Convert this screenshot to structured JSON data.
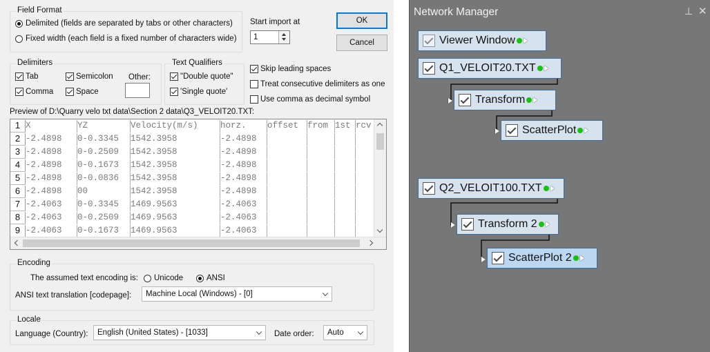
{
  "dialog": {
    "field_format": {
      "legend": "Field Format",
      "delimited_label": "Delimited (fields are separated by tabs or other characters)",
      "fixed_label": "Fixed width (each field is a fixed number of characters wide)"
    },
    "start_import": {
      "label": "Start import at",
      "value": "1"
    },
    "ok_label": "OK",
    "cancel_label": "Cancel",
    "delimiters": {
      "legend": "Delimiters",
      "tab": "Tab",
      "semicolon": "Semicolon",
      "comma": "Comma",
      "space": "Space",
      "other": "Other:",
      "other_value": ""
    },
    "qualifiers": {
      "legend": "Text Qualifiers",
      "double": "\"Double quote\"",
      "single": "'Single quote'"
    },
    "options": {
      "skip_leading": "Skip leading spaces",
      "treat_consecutive": "Treat consecutive delimiters as one",
      "use_comma": "Use comma as decimal symbol"
    },
    "preview": {
      "label": "Preview of D:\\Quarry velo txt data\\Section 2 data\\Q3_VELOIT20.TXT:",
      "rows": [
        {
          "num": "1",
          "cells": [
            "X",
            "YZ",
            "Velocity(m/s)",
            "horz.",
            "offset",
            "from",
            "1st",
            "rcv"
          ]
        },
        {
          "num": "2",
          "cells": [
            "-2.4898",
            "0-0.3345",
            "1542.3958",
            "-2.4898",
            "",
            "",
            "",
            ""
          ]
        },
        {
          "num": "3",
          "cells": [
            "-2.4898",
            "0-0.2509",
            "1542.3958",
            "-2.4898",
            "",
            "",
            "",
            ""
          ]
        },
        {
          "num": "4",
          "cells": [
            "-2.4898",
            "0-0.1673",
            "1542.3958",
            "-2.4898",
            "",
            "",
            "",
            ""
          ]
        },
        {
          "num": "5",
          "cells": [
            "-2.4898",
            "0-0.0836",
            "1542.3958",
            "-2.4898",
            "",
            "",
            "",
            ""
          ]
        },
        {
          "num": "6",
          "cells": [
            "-2.4898",
            "00",
            "1542.3958",
            "-2.4898",
            "",
            "",
            "",
            ""
          ]
        },
        {
          "num": "7",
          "cells": [
            "-2.4063",
            "0-0.3345",
            "1469.9563",
            "-2.4063",
            "",
            "",
            "",
            ""
          ]
        },
        {
          "num": "8",
          "cells": [
            "-2.4063",
            "0-0.2509",
            "1469.9563",
            "-2.4063",
            "",
            "",
            "",
            ""
          ]
        },
        {
          "num": "9",
          "cells": [
            "-2.4063",
            "0-0.1673",
            "1469.9563",
            "-2.4063",
            "",
            "",
            "",
            ""
          ]
        }
      ]
    },
    "encoding": {
      "legend": "Encoding",
      "assumed_label": "The assumed text encoding is:",
      "unicode": "Unicode",
      "ansi": "ANSI",
      "translation_label": "ANSI text translation [codepage]:",
      "translation_value": "Machine Local (Windows) - [0]"
    },
    "locale": {
      "legend": "Locale",
      "language_label": "Language (Country):",
      "language_value": "English (United States) - [1033]",
      "date_order_label": "Date order:",
      "date_order_value": "Auto"
    }
  },
  "network_manager": {
    "title": "Network Manager",
    "pin_icon": "pin-icon",
    "close_icon": "close-icon",
    "nodes": [
      {
        "label": "Viewer Window"
      },
      {
        "label": "Q1_VELOIT20.TXT"
      },
      {
        "label": "Transform"
      },
      {
        "label": "ScatterPlot"
      },
      {
        "label": "Q2_VELOIT100.TXT"
      },
      {
        "label": "Transform 2"
      },
      {
        "label": "ScatterPlot 2"
      }
    ]
  }
}
